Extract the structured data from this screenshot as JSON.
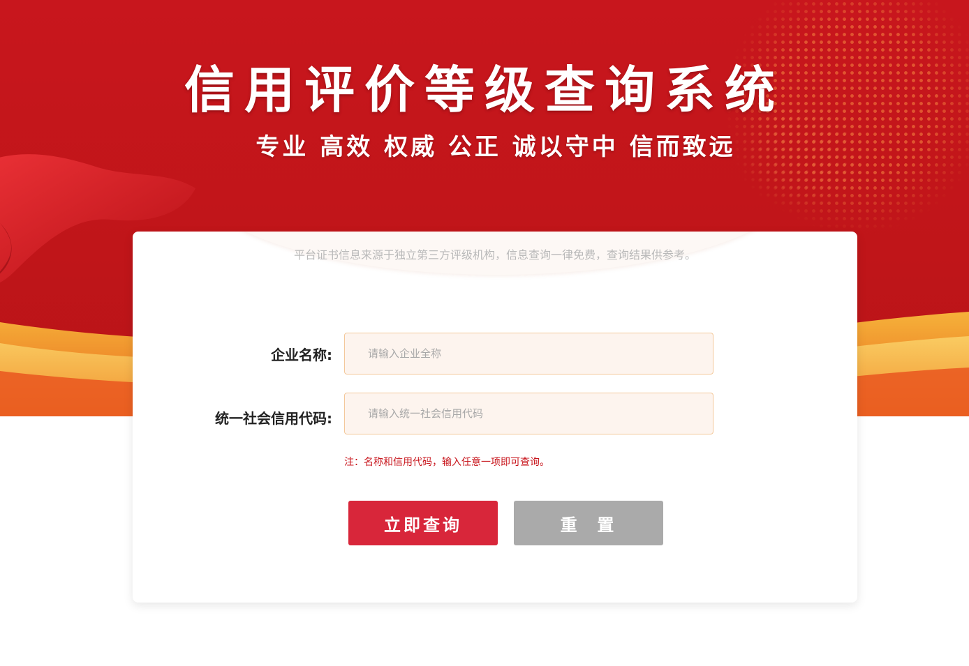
{
  "header": {
    "title": "信用评价等级查询系统",
    "slogan": "专业 高效 权威 公正 诚以守中 信而致远"
  },
  "notice": {
    "text": "平台证书信息来源于独立第三方评级机构，信息查询一律免费，查询结果供参考。"
  },
  "form": {
    "company_label": "企业名称:",
    "company_placeholder": "请输入企业全称",
    "company_value": "",
    "code_label": "统一社会信用代码:",
    "code_placeholder": "请输入统一社会信用代码",
    "code_value": "",
    "hint": "注：名称和信用代码，输入任意一项即可查询。",
    "submit_label": "立即查询",
    "reset_label": "重  置"
  },
  "colors": {
    "banner_red": "#c8161d",
    "primary_button": "#d8263a",
    "reset_button": "#aaaaaa",
    "input_bg": "#fdf4ee",
    "input_border": "#f3c89a",
    "hint_text": "#c8161d"
  }
}
